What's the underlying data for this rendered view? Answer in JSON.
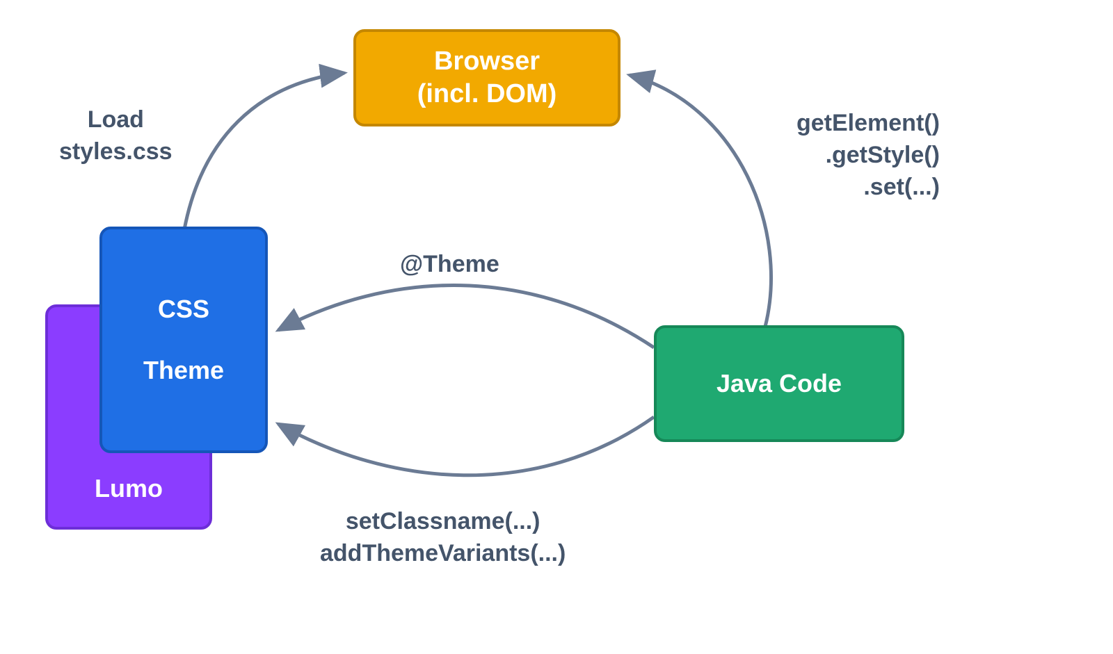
{
  "nodes": {
    "browser": {
      "line1": "Browser",
      "line2": "(incl. DOM)",
      "fill": "#f2a900",
      "border": "#c48700"
    },
    "lumo": {
      "label": "Lumo",
      "fill": "#8b3dff",
      "border": "#6d2ed8"
    },
    "csstheme": {
      "line1": "CSS",
      "line2": "Theme",
      "fill": "#1f6fe5",
      "border": "#1556b8"
    },
    "java": {
      "label": "Java Code",
      "fill": "#1fa971",
      "border": "#168858"
    }
  },
  "labels": {
    "load": {
      "line1": "Load",
      "line2": "styles.css"
    },
    "getelement": {
      "line1": "getElement()",
      "line2": ".getStyle()",
      "line3": ".set(...)"
    },
    "theme": "@Theme",
    "setclass": {
      "line1": "setClassname(...)",
      "line2": "addThemeVariants(...)"
    }
  },
  "colors": {
    "arrow": "#6b7b94",
    "text": "#44546a"
  }
}
